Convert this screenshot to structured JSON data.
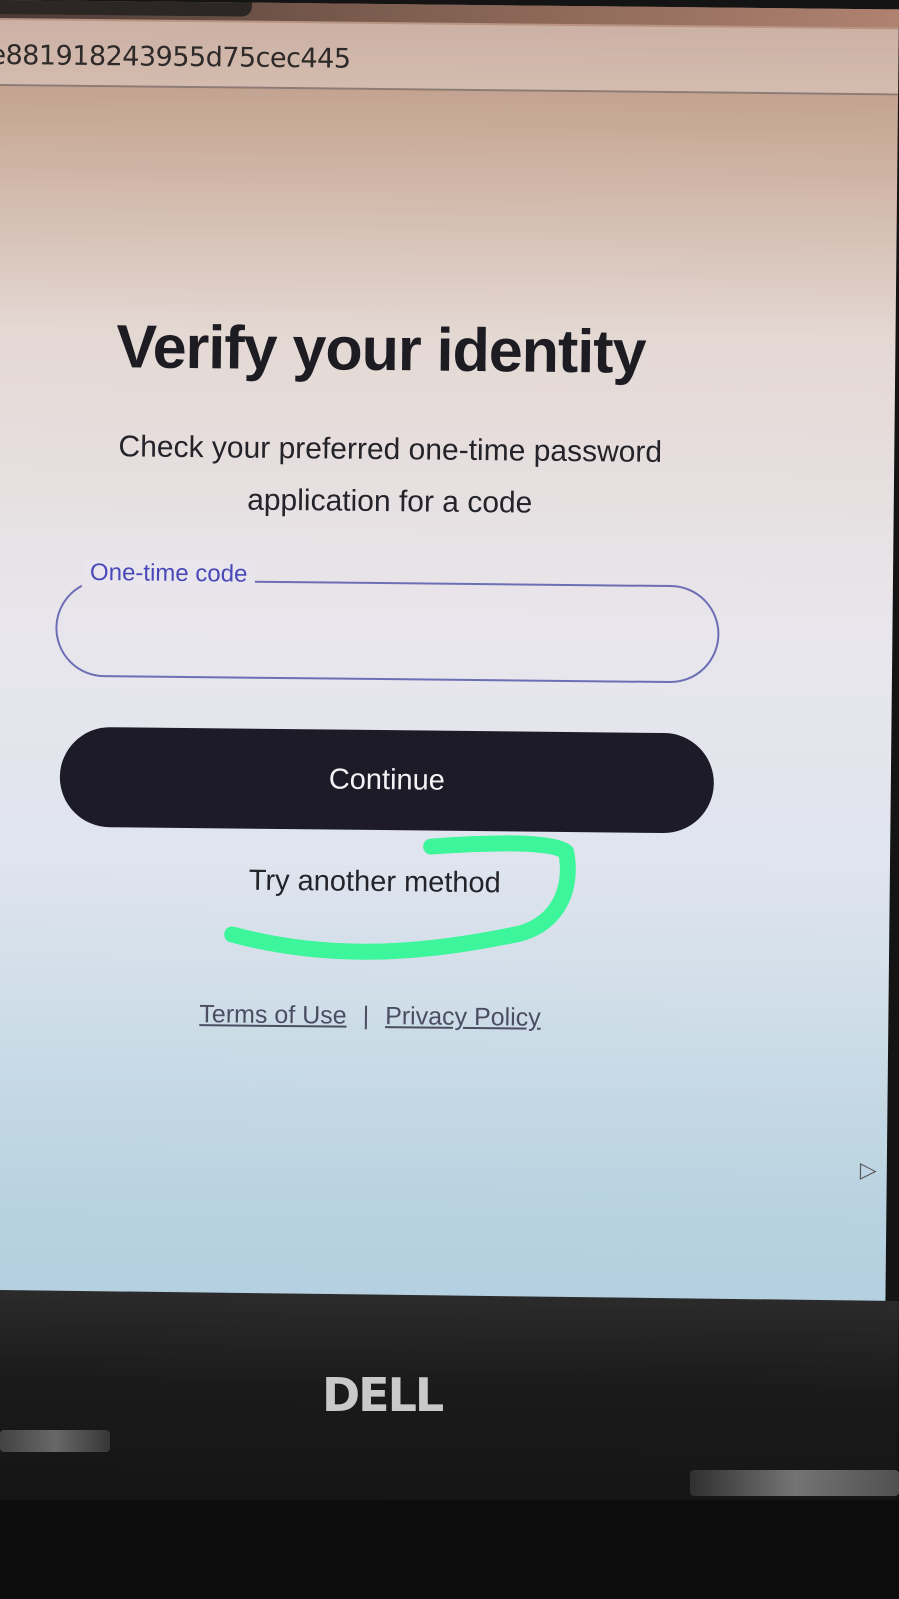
{
  "browser": {
    "url_fragment": "e881918243955d75cec445"
  },
  "page": {
    "title": "Verify your identity",
    "instructions": "Check your preferred one-time password application for a code"
  },
  "form": {
    "code_label": "One-time code",
    "code_value": "",
    "continue_label": "Continue",
    "try_another_label": "Try another method"
  },
  "footer": {
    "terms_label": "Terms of Use",
    "separator": "|",
    "privacy_label": "Privacy Policy"
  },
  "device": {
    "logo": "DELL"
  },
  "colors": {
    "button_bg": "#1d1b27",
    "field_border": "#6d6fb4",
    "field_label": "#4a48b9",
    "highlight_stroke": "#3df59a"
  }
}
